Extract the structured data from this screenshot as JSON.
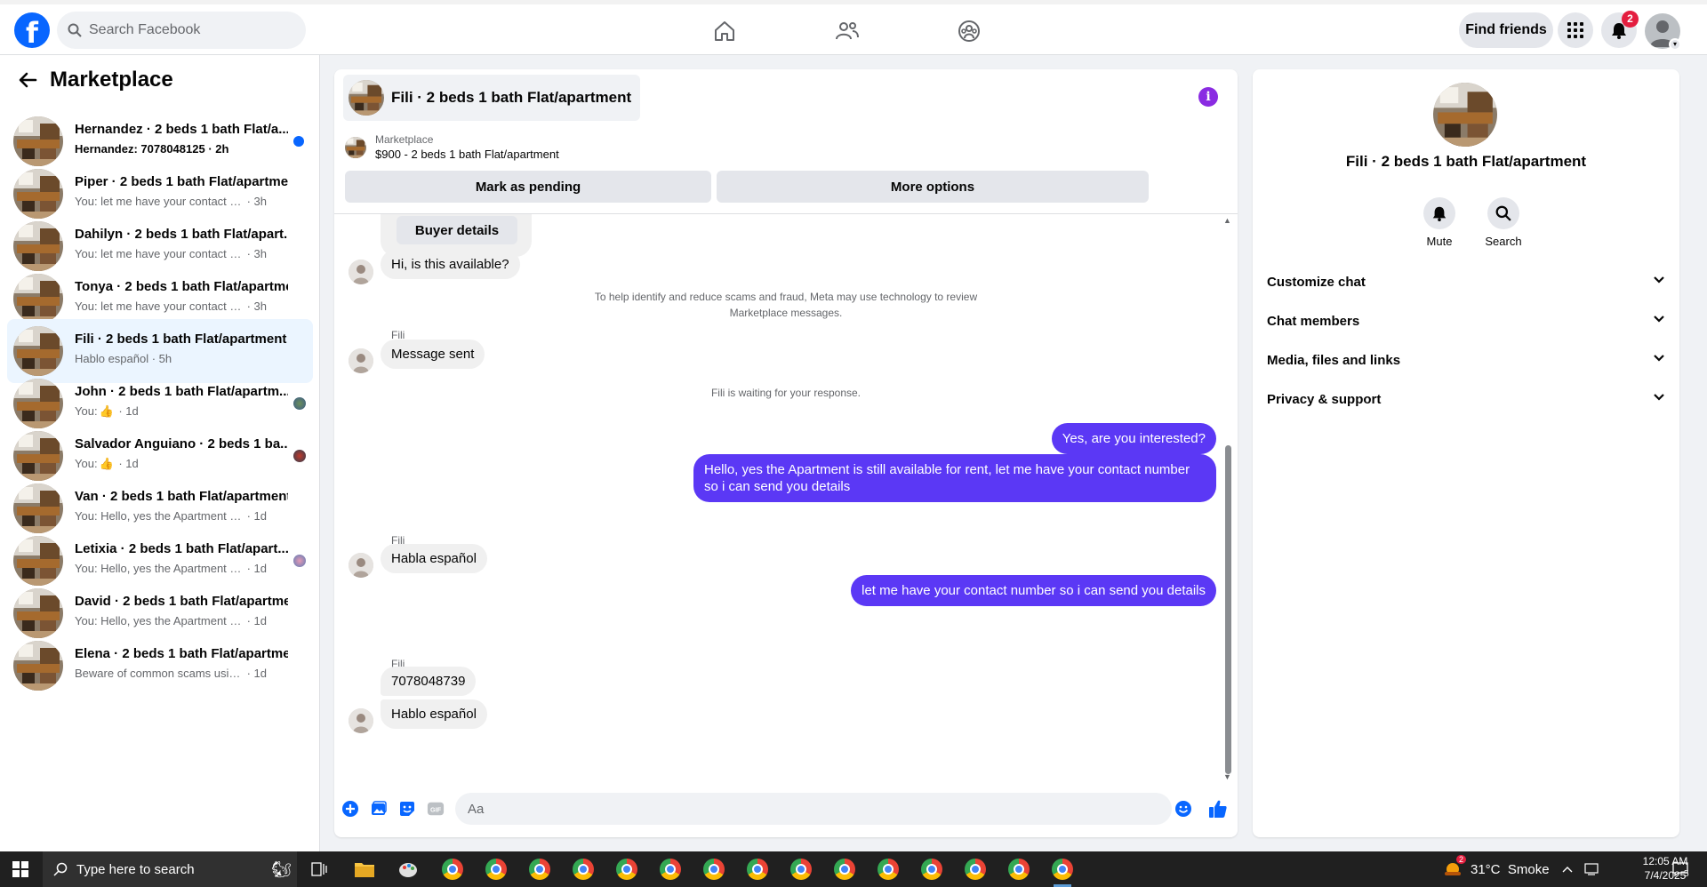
{
  "topnav": {
    "logo": "f",
    "search_placeholder": "Search Facebook",
    "find_friends": "Find friends",
    "notification_count": "2"
  },
  "sidebar": {
    "title": "Marketplace",
    "conversations": [
      {
        "name": "Hernandez · 2 beds 1 bath Flat/a...",
        "preview": "Hernandez: 7078048125",
        "time": " · 2h",
        "unread": true
      },
      {
        "name": "Piper · 2 beds 1 bath Flat/apartment",
        "preview": "You: let me have your contact number...",
        "time": " · 3h"
      },
      {
        "name": "Dahilyn · 2 beds 1 bath Flat/apart...",
        "preview": "You: let me have your contact number...",
        "time": " · 3h"
      },
      {
        "name": "Tonya · 2 beds 1 bath Flat/apartme...",
        "preview": "You: let me have your contact number...",
        "time": " · 3h"
      },
      {
        "name": "Fili · 2 beds 1 bath Flat/apartment",
        "preview": "Hablo español",
        "time": " · 5h",
        "active": true
      },
      {
        "name": "John · 2 beds 1 bath Flat/apartm...",
        "preview": "You: ",
        "time": " · 1d"
      },
      {
        "name": "Salvador Anguiano · 2 beds 1 ba...",
        "preview": "You: ",
        "time": " · 1d"
      },
      {
        "name": "Van · 2 beds 1 bath Flat/apartment",
        "preview": "You: Hello, yes the Apartment is still a...",
        "time": " · 1d"
      },
      {
        "name": "Letixia · 2 beds 1 bath Flat/apart...",
        "preview": "You: Hello, yes the Apartment is stil...",
        "time": " · 1d"
      },
      {
        "name": "David · 2 beds 1 bath Flat/apartment",
        "preview": "You: Hello, yes the Apartment is still a...",
        "time": " · 1d"
      },
      {
        "name": "Elena · 2 beds 1 bath Flat/apartment",
        "preview": "Beware of common scams using pay...",
        "time": " · 1d"
      }
    ]
  },
  "chat": {
    "title": "Fili · 2 beds 1 bath Flat/apartment",
    "info_icon": "i",
    "marketplace_label": "Marketplace",
    "listing": "$900 - 2 beds 1 bath Flat/apartment",
    "mark_pending": "Mark as pending",
    "more_options": "More options",
    "buyer_details": "Buyer details",
    "messages": {
      "m1": "Hi, is this available?",
      "notice_line1": "To help identify and reduce scams and fraud, Meta may use technology to review",
      "notice_line2": "Marketplace messages.",
      "sender": "Fili",
      "m2": "Message sent",
      "waiting": "Fili is waiting for your response.",
      "out1": "Yes, are you interested?",
      "out2": "Hello, yes the Apartment is still available for rent, let me have your contact number so i can send you details",
      "m3": "Habla español",
      "out3": "let me have your contact number so i can send you details",
      "m4": "7078048739",
      "m5": "Hablo español"
    },
    "composer_placeholder": "Aa"
  },
  "rightpanel": {
    "title": "Fili · 2 beds 1 bath Flat/apartment",
    "mute": "Mute",
    "search": "Search",
    "sections": [
      "Customize chat",
      "Chat members",
      "Media, files and links",
      "Privacy & support"
    ]
  },
  "taskbar": {
    "search_placeholder": "Type here to search",
    "weather_badge": "2",
    "weather": "31°C  Smoke",
    "time": "12:05 AM",
    "date": "7/4/2025",
    "notif_count": "5"
  },
  "colors": {
    "brand": "#0866ff",
    "outgoing_bubble": "#5b38f5",
    "active_conversation": "#ebf5ff"
  }
}
